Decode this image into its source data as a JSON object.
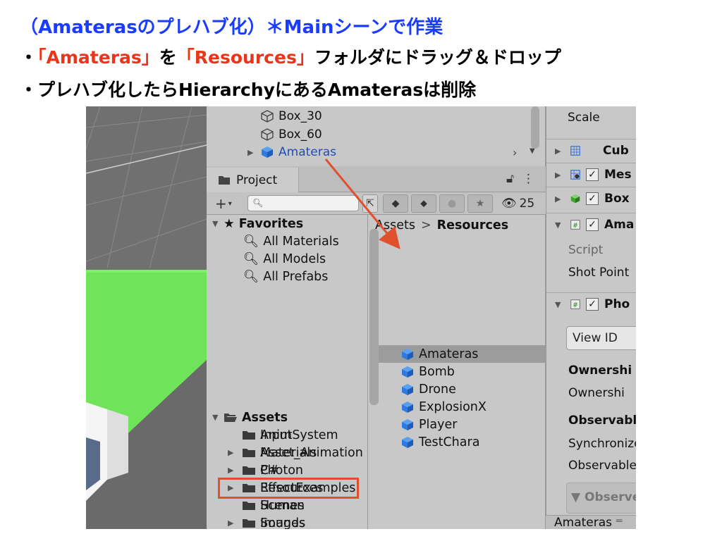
{
  "slide": {
    "title": "（Amaterasのプレハブ化）＊Mainシーンで作業",
    "bullet1": {
      "dot": "・",
      "name1": "「Amateras」",
      "wo": "を",
      "name2": "「Resources」",
      "rest": "フォルダにドラッグ＆ドロップ"
    },
    "bullet2": {
      "dot": "・",
      "text": "プレハブ化したらHierarchyにあるAmaterasは削除"
    }
  },
  "hierarchy": {
    "items": [
      {
        "label": "Box_30",
        "icon": "cube-outline-icon"
      },
      {
        "label": "Box_60",
        "icon": "cube-outline-icon"
      },
      {
        "label": "Amateras",
        "icon": "prefab-cube-icon",
        "selected": true
      }
    ]
  },
  "project": {
    "tab_label": "Project",
    "search_placeholder": "",
    "hidden_count": "25",
    "tree": [
      {
        "label": "Favorites",
        "bold": true,
        "expanded": true,
        "icon": "star-icon"
      },
      {
        "label": "All Materials",
        "icon": "search-icon"
      },
      {
        "label": "All Models",
        "icon": "search-icon"
      },
      {
        "label": "All Prefabs",
        "icon": "search-icon"
      },
      {
        "label": "Assets",
        "bold": true,
        "expanded": true,
        "icon": "folder-open-icon"
      },
      {
        "label": "Anim",
        "icon": "folder-icon"
      },
      {
        "label": "Asset_Animation",
        "icon": "folder-icon",
        "collapsed": true
      },
      {
        "label": "C#",
        "icon": "folder-icon"
      },
      {
        "label": "EffectExamples",
        "icon": "folder-icon",
        "collapsed": true
      },
      {
        "label": "Human",
        "icon": "folder-icon"
      },
      {
        "label": "Images",
        "icon": "folder-icon",
        "collapsed": true
      },
      {
        "label": "InputSystem",
        "icon": "folder-icon"
      },
      {
        "label": "Materials",
        "icon": "folder-icon"
      },
      {
        "label": "Photon",
        "icon": "folder-icon",
        "collapsed": true
      },
      {
        "label": "Resources",
        "icon": "folder-icon",
        "highlighted": true
      },
      {
        "label": "Scenes",
        "icon": "folder-icon"
      },
      {
        "label": "Sounds",
        "icon": "folder-icon"
      }
    ],
    "breadcrumb": {
      "root": "Assets",
      "separator": ">",
      "current": "Resources"
    },
    "assets": [
      {
        "label": "Amateras",
        "selected": true
      },
      {
        "label": "Bomb"
      },
      {
        "label": "Drone"
      },
      {
        "label": "ExplosionX"
      },
      {
        "label": "Player"
      },
      {
        "label": "TestChara"
      }
    ]
  },
  "inspector": {
    "scale_label": "Scale",
    "components": [
      "Cub",
      "Mes",
      "Box",
      "Ama",
      "Pho"
    ],
    "script_label": "Script",
    "shot_point_label": "Shot Point",
    "view_id_label": "View ID",
    "ownership_header": "Ownershi",
    "ownership_label": "Ownershi",
    "observable_header": "Observable",
    "synchronize_label": "Synchronize",
    "observable_label": "Observable",
    "observe_box_label": "▼ Observe",
    "bottom_label": "Amateras"
  },
  "colors": {
    "title_blue": "#1a3cff",
    "highlight_red": "#e8351c",
    "prefab_blue": "#2f7ae0",
    "ground_green": "#6fe35a",
    "selection_gray": "#9c9c9c"
  }
}
